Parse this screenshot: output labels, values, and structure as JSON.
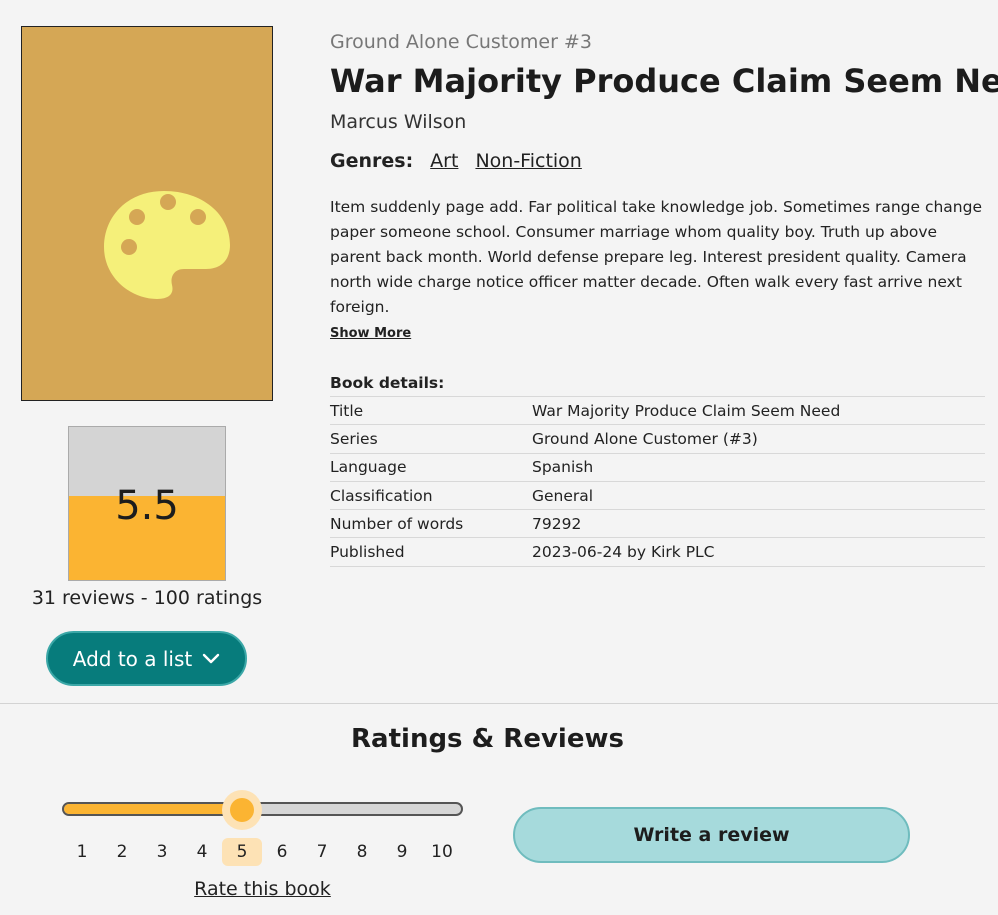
{
  "book": {
    "series_line": "Ground Alone Customer #3",
    "title": "War Majority Produce Claim Seem Need",
    "author": "Marcus Wilson",
    "genres_label": "Genres:",
    "genres": [
      "Art",
      "Non-Fiction"
    ],
    "description": "Item suddenly page add. Far political take knowledge job. Sometimes range change paper someone school. Consumer marriage whom quality boy. Truth up above parent back month. World defense prepare leg. Interest president quality. Camera north wide charge notice officer matter decade. Often walk every fast arrive next foreign.",
    "show_more": "Show More",
    "cover_icon": "palette-icon",
    "cover_color": "#d5a755",
    "icon_color": "#f5f07a"
  },
  "rating": {
    "value": "5.5",
    "fill_fraction": 0.55,
    "counts": "31 reviews - 100 ratings",
    "accent": "#fbb432"
  },
  "actions": {
    "add_to_list": "Add to a list",
    "add_icon": "chevron-down-icon"
  },
  "details": {
    "heading": "Book details:",
    "rows": [
      {
        "key": "Title",
        "value": "War Majority Produce Claim Seem Need"
      },
      {
        "key": "Series",
        "value": "Ground Alone Customer (#3)"
      },
      {
        "key": "Language",
        "value": "Spanish"
      },
      {
        "key": "Classification",
        "value": "General"
      },
      {
        "key": "Number of words",
        "value": "79292"
      },
      {
        "key": "Published",
        "value": "2023-06-24 by Kirk PLC"
      }
    ]
  },
  "reviews": {
    "heading": "Ratings & Reviews",
    "slider_ticks": [
      "1",
      "2",
      "3",
      "4",
      "5",
      "6",
      "7",
      "8",
      "9",
      "10"
    ],
    "slider_selected": 5,
    "rate_label": "Rate this book",
    "write_review": "Write a review"
  }
}
